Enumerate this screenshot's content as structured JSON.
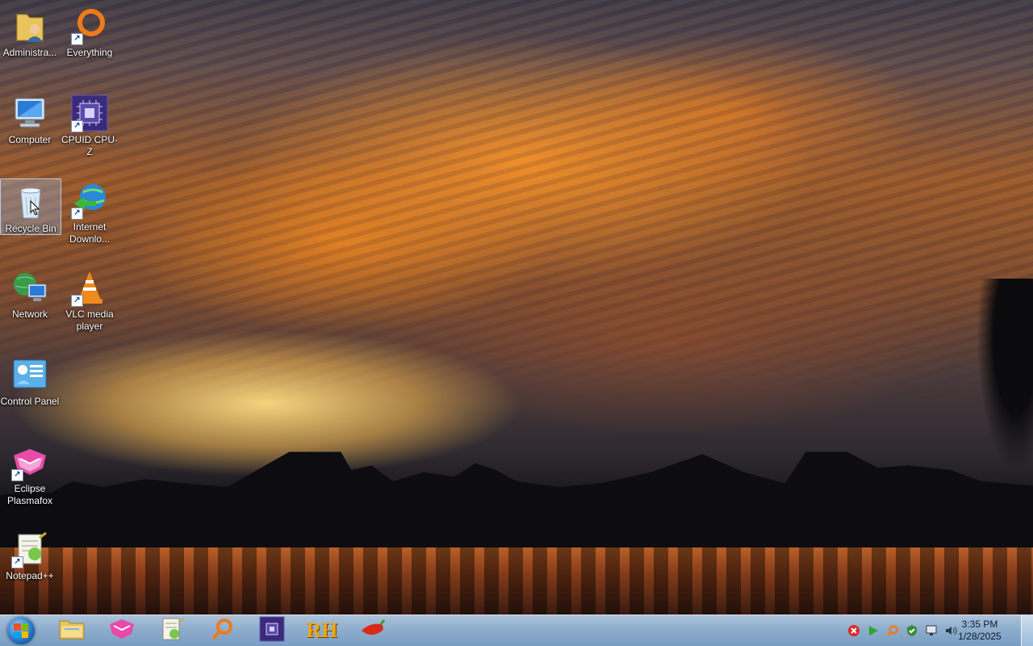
{
  "desktop": {
    "icons": [
      {
        "label": "Administra...",
        "icon": "user-folder-icon",
        "shortcut": false
      },
      {
        "label": "Everything",
        "icon": "everything-search-icon",
        "shortcut": true
      },
      {
        "label": "Computer",
        "icon": "computer-icon",
        "shortcut": false
      },
      {
        "label": "CPUID CPU-Z",
        "icon": "cpuz-icon",
        "shortcut": true
      },
      {
        "label": "Recycle Bin",
        "icon": "recycle-bin-icon",
        "shortcut": false,
        "selected": true
      },
      {
        "label": "Internet Downlo...",
        "icon": "internet-download-manager-icon",
        "shortcut": true
      },
      {
        "label": "Network",
        "icon": "network-icon",
        "shortcut": false
      },
      {
        "label": "VLC media player",
        "icon": "vlc-icon",
        "shortcut": true
      },
      {
        "label": "Control Panel",
        "icon": "control-panel-icon",
        "shortcut": false
      },
      {
        "label": "Eclipse Plasmafox",
        "icon": "eclipse-plasmafox-icon",
        "shortcut": true
      },
      {
        "label": "Notepad++",
        "icon": "notepad-plus-plus-icon",
        "shortcut": true
      }
    ]
  },
  "taskbar": {
    "start_icon": "windows-start-icon",
    "pinned": [
      {
        "name": "File Explorer",
        "icon": "file-explorer-icon"
      },
      {
        "name": "Eclipse Plasmafox",
        "icon": "eclipse-plasmafox-icon"
      },
      {
        "name": "Notepad++",
        "icon": "notepad-plus-plus-icon"
      },
      {
        "name": "Everything",
        "icon": "everything-search-icon"
      },
      {
        "name": "CPUID CPU-Z",
        "icon": "cpuz-icon"
      },
      {
        "name": "Resource Hacker",
        "icon": "resource-hacker-icon",
        "text": "RH"
      },
      {
        "name": "Red Pepper",
        "icon": "pepper-icon"
      }
    ],
    "tray": [
      {
        "icon": "tray-x-icon"
      },
      {
        "icon": "tray-play-icon"
      },
      {
        "icon": "tray-search-icon"
      },
      {
        "icon": "tray-shield-check-icon"
      },
      {
        "icon": "tray-network-icon"
      },
      {
        "icon": "tray-volume-icon"
      }
    ],
    "clock": {
      "time": "3:35 PM",
      "date": "1/28/2025"
    }
  },
  "colors": {
    "taskbar": "#9bbce0",
    "selection": "#8cb4e6",
    "text": "#ffffff"
  }
}
